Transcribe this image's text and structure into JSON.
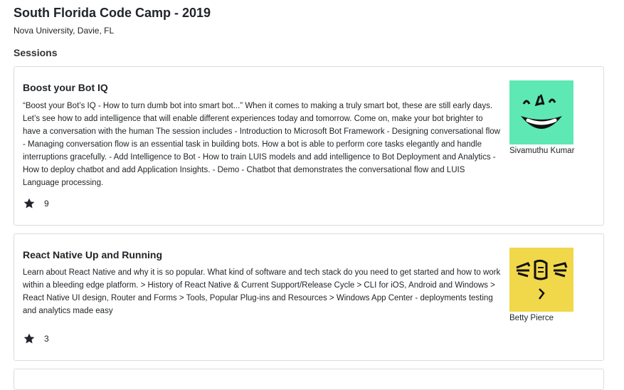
{
  "event": {
    "title": "South Florida Code Camp - 2019",
    "location": "Nova University, Davie, FL"
  },
  "sessions_heading": "Sessions",
  "sessions": [
    {
      "title": "Boost your Bot IQ",
      "description": "“Boost your Bot’s IQ - How to turn dumb bot into smart bot...” When it comes to making a truly smart bot, these are still early days. Let’s see how to add intelligence that will enable different experiences today and tomorrow. Come on, make your bot brighter to have a conversation with the human The session includes - Introduction to Microsoft Bot Framework - Designing conversational flow - Managing conversation flow is an essential task in building bots. How a bot is able to perform core tasks elegantly and handle interruptions gracefully. - Add Intelligence to Bot - How to train LUIS models and add intelligence to Bot Deployment and Analytics - How to deploy chatbot and add Application Insights. - Demo - Chatbot that demonstrates the conversational flow and LUIS Language processing.",
      "rating": "9",
      "speaker": "Sivamuthu Kumar",
      "avatar_color": "#5ee8b4"
    },
    {
      "title": "React Native Up and Running",
      "description": "Learn about React Native and why it is so popular. What kind of software and tech stack do you need to get started and how to work within a bleeding edge platform. > History of React Native & Current Support/Release Cycle > CLI for iOS, Android and Windows > React Native UI design, Router and Forms > Tools, Popular Plug-ins and Resources > Windows App Center - deployments testing and analytics made easy",
      "rating": "3",
      "speaker": "Betty Pierce",
      "avatar_color": "#f0d84a"
    }
  ],
  "icons": {
    "rating": "star-icon"
  }
}
